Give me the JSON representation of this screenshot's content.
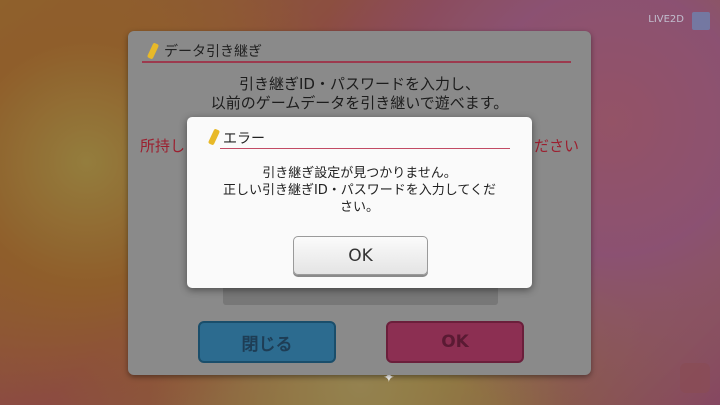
{
  "background": {
    "top_left_text": "",
    "logo_text": "LIVE2D",
    "bottom_info": "",
    "bottom_info_right": ""
  },
  "outer_dialog": {
    "title": "データ引き継ぎ",
    "description_line1": "引き継ぎID・パスワードを入力し、",
    "description_line2": "以前のゲームデータを引き継いで遊べます。",
    "red_text_left": "所持し",
    "red_text_right": "ださい",
    "close_label": "閉じる",
    "ok_label": "OK"
  },
  "error_dialog": {
    "title": "エラー",
    "message_line1": "引き継ぎ設定が見つかりません。",
    "message_line2": "正しい引き継ぎID・パスワードを入力してくだ",
    "message_line3": "さい。",
    "ok_label": "OK"
  },
  "colors": {
    "accent_line": "#c24a64",
    "pen_icon": "#e8b928",
    "close_button": "#2c6b8f",
    "ok_button": "#8c2f52"
  }
}
